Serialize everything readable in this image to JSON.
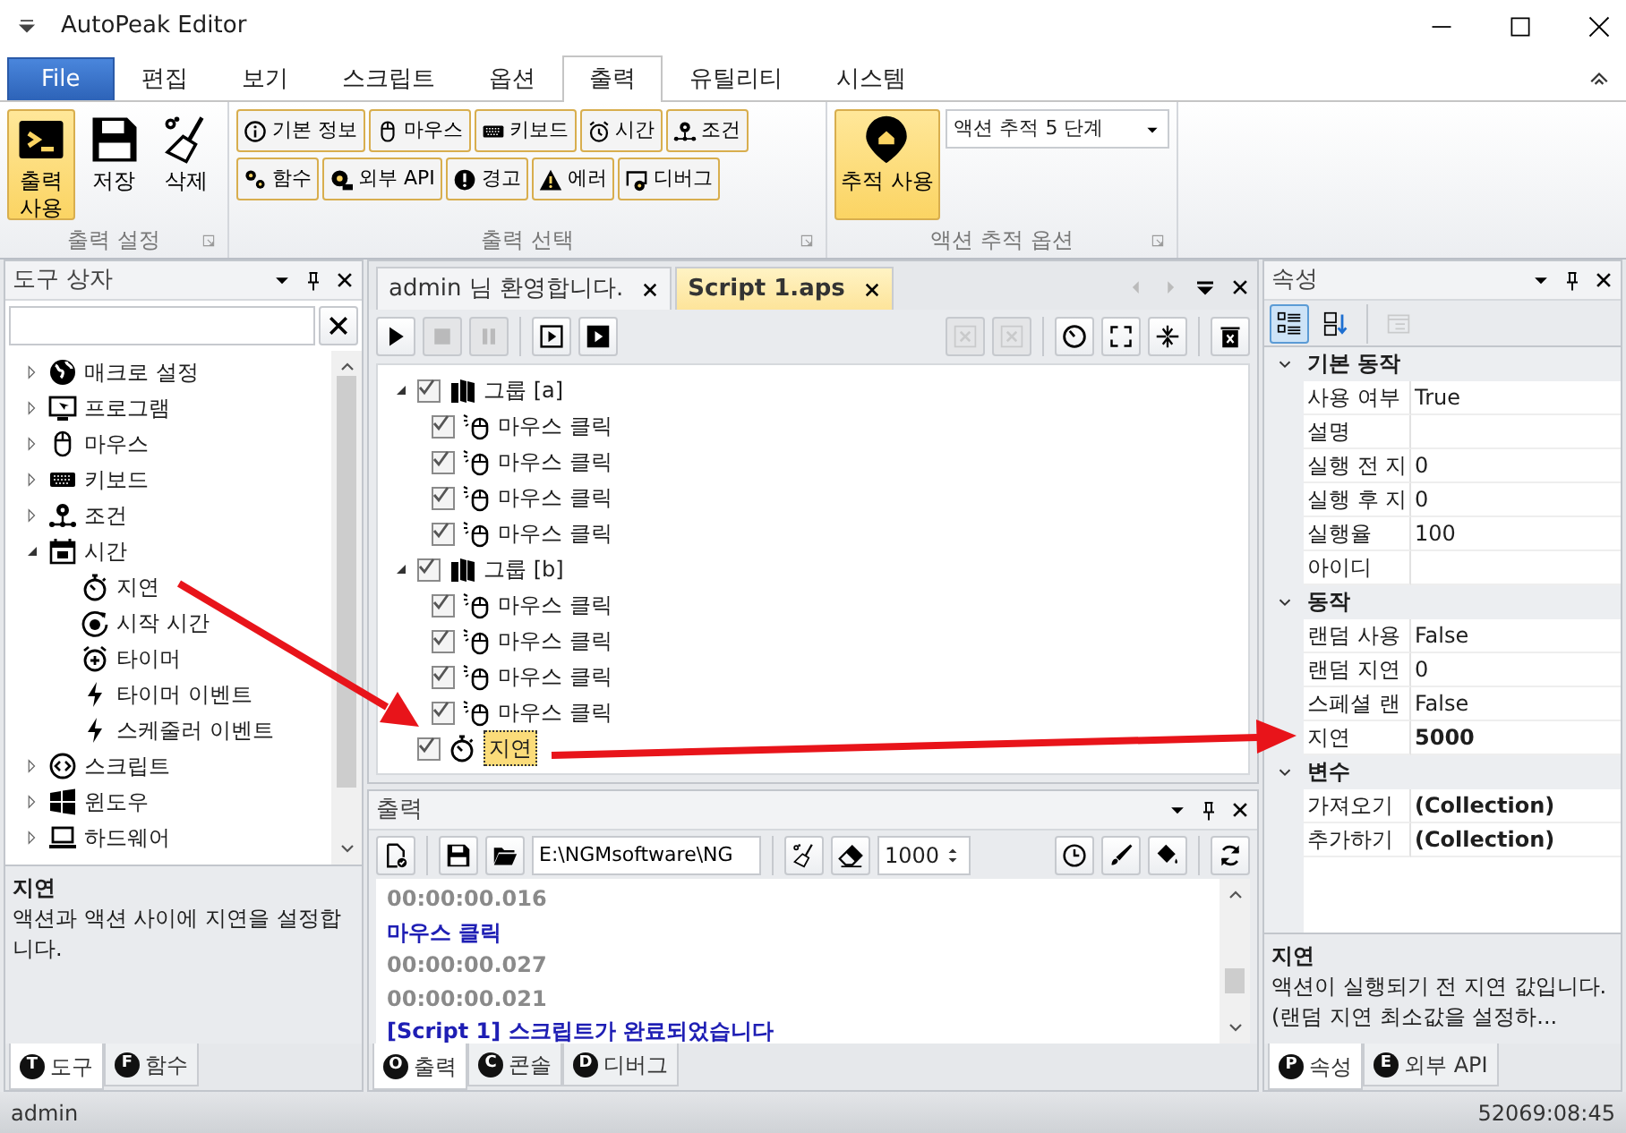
{
  "window": {
    "title": "AutoPeak Editor"
  },
  "ribbon_tabs": [
    {
      "label": "File",
      "kind": "file",
      "selected": false
    },
    {
      "label": "편집",
      "kind": "tab",
      "selected": false
    },
    {
      "label": "보기",
      "kind": "tab",
      "selected": false
    },
    {
      "label": "스크립트",
      "kind": "tab",
      "selected": false
    },
    {
      "label": "옵션",
      "kind": "tab",
      "selected": false
    },
    {
      "label": "출력",
      "kind": "tab",
      "selected": true
    },
    {
      "label": "유틸리티",
      "kind": "tab",
      "selected": false
    },
    {
      "label": "시스템",
      "kind": "tab",
      "selected": false
    }
  ],
  "output_settings": {
    "title": "출력 설정",
    "buttons": [
      {
        "label": "출력 사용",
        "on": true
      },
      {
        "label": "저장",
        "on": false
      },
      {
        "label": "삭제",
        "on": false
      }
    ]
  },
  "output_select": {
    "title": "출력 선택",
    "rows": [
      [
        {
          "label": "기본 정보",
          "on": true
        },
        {
          "label": "마우스",
          "on": true
        },
        {
          "label": "키보드",
          "on": true
        },
        {
          "label": "시간",
          "on": true
        },
        {
          "label": "조건",
          "on": true
        }
      ],
      [
        {
          "label": "함수",
          "on": true
        },
        {
          "label": "외부 API",
          "on": true
        },
        {
          "label": "경고",
          "on": true
        },
        {
          "label": "에러",
          "on": true
        },
        {
          "label": "디버그",
          "on": true
        }
      ]
    ]
  },
  "trace_options": {
    "title": "액션 추적 옵션",
    "button": {
      "label": "추적 사용",
      "on": true
    },
    "dropdown": {
      "value": "액션 추적 5 단계"
    }
  },
  "toolbox": {
    "title": "도구 상자",
    "items": [
      {
        "label": "매크로 설정",
        "expanded": false
      },
      {
        "label": "프로그램",
        "expanded": false
      },
      {
        "label": "마우스",
        "expanded": false
      },
      {
        "label": "키보드",
        "expanded": false
      },
      {
        "label": "조건",
        "expanded": false
      },
      {
        "label": "시간",
        "expanded": true,
        "children": [
          {
            "label": "지연"
          },
          {
            "label": "시작 시간"
          },
          {
            "label": "타이머"
          },
          {
            "label": "타이머 이벤트"
          },
          {
            "label": "스케줄러 이벤트"
          }
        ]
      },
      {
        "label": "스크립트",
        "expanded": false
      },
      {
        "label": "윈도우",
        "expanded": false
      },
      {
        "label": "하드웨어",
        "expanded": false
      }
    ],
    "description": {
      "title": "지연",
      "text": "액션과 액션 사이에 지연을 설정합니다."
    },
    "tabs": [
      {
        "badge": "T",
        "label": "도구",
        "selected": true
      },
      {
        "badge": "F",
        "label": "함수",
        "selected": false
      }
    ]
  },
  "document_tabs": [
    {
      "label": "admin 님 환영합니다.",
      "selected": false
    },
    {
      "label": "Script 1.aps",
      "selected": true
    }
  ],
  "script_toolbar": [
    {
      "disabled": false
    },
    {
      "disabled": true
    },
    {
      "disabled": true
    },
    {
      "disabled": false
    },
    {
      "disabled": false
    },
    {
      "disabled": true
    },
    {
      "disabled": true
    },
    {
      "disabled": false
    },
    {
      "disabled": false
    },
    {
      "disabled": false
    },
    {
      "disabled": false
    }
  ],
  "script": [
    {
      "kind": "group",
      "label": "그룹 [a]",
      "checked": true,
      "expanded": true,
      "selected": false,
      "children": [
        {
          "kind": "mouse",
          "label": "마우스 클릭",
          "checked": true,
          "selected": false
        },
        {
          "kind": "mouse",
          "label": "마우스 클릭",
          "checked": true,
          "selected": false
        },
        {
          "kind": "mouse",
          "label": "마우스 클릭",
          "checked": true,
          "selected": false
        },
        {
          "kind": "mouse",
          "label": "마우스 클릭",
          "checked": true,
          "selected": false
        }
      ]
    },
    {
      "kind": "group",
      "label": "그룹 [b]",
      "checked": true,
      "expanded": true,
      "selected": false,
      "children": [
        {
          "kind": "mouse",
          "label": "마우스 클릭",
          "checked": true,
          "selected": false
        },
        {
          "kind": "mouse",
          "label": "마우스 클릭",
          "checked": true,
          "selected": false
        },
        {
          "kind": "mouse",
          "label": "마우스 클릭",
          "checked": true,
          "selected": false
        },
        {
          "kind": "mouse",
          "label": "마우스 클릭",
          "checked": true,
          "selected": false
        }
      ]
    },
    {
      "kind": "delay",
      "label": "지연",
      "checked": true,
      "selected": true
    }
  ],
  "output": {
    "title": "출력",
    "path": "E:\\NGMsoftware\\NG",
    "count": "1000",
    "log": [
      {
        "kind": "time",
        "text": "00:00:00.016"
      },
      {
        "kind": "message",
        "text": "마우스 클릭"
      },
      {
        "kind": "time",
        "text": "00:00:00.027"
      },
      {
        "kind": "time",
        "text": "00:00:00.021"
      },
      {
        "kind": "message",
        "text": "[Script 1] 스크립트가 완료되었습니다"
      }
    ],
    "tabs": [
      {
        "badge": "O",
        "label": "출력",
        "selected": true
      },
      {
        "badge": "C",
        "label": "콘솔",
        "selected": false
      },
      {
        "badge": "D",
        "label": "디버그",
        "selected": false
      }
    ]
  },
  "properties": {
    "title": "속성",
    "toolbar": [
      {
        "selected": true,
        "disabled": false
      },
      {
        "selected": false,
        "disabled": false
      },
      {
        "selected": false,
        "disabled": true
      }
    ],
    "categories": [
      {
        "name": "기본 동작",
        "expanded": true,
        "rows": [
          {
            "name": "사용 여부",
            "value": "True",
            "modified": false
          },
          {
            "name": "설명",
            "modified": false
          },
          {
            "name": "실행 전 지",
            "value": "0",
            "modified": false
          },
          {
            "name": "실행 후 지",
            "value": "0",
            "modified": false
          },
          {
            "name": "실행율",
            "value": "100",
            "modified": false
          },
          {
            "name": "아이디",
            "modified": false
          }
        ]
      },
      {
        "name": "동작",
        "expanded": true,
        "rows": [
          {
            "name": "랜덤 사용",
            "value": "False",
            "modified": false
          },
          {
            "name": "랜덤 지연",
            "value": "0",
            "modified": false
          },
          {
            "name": "스페셜 랜",
            "value": "False",
            "modified": false
          },
          {
            "name": "지연",
            "value": "5000",
            "modified": true
          }
        ]
      },
      {
        "name": "변수",
        "expanded": true,
        "rows": [
          {
            "name": "가져오기",
            "value": "(Collection)",
            "modified": true
          },
          {
            "name": "추가하기",
            "value": "(Collection)",
            "modified": true
          }
        ]
      }
    ],
    "description": {
      "title": "지연",
      "text": "액션이 실행되기 전 지연 값입니다. (랜덤 지연 최소값을 설정하..."
    },
    "tabs": [
      {
        "badge": "P",
        "label": "속성",
        "selected": true
      },
      {
        "badge": "E",
        "label": "외부 API",
        "selected": false
      }
    ]
  },
  "status_bar": {
    "user": "admin",
    "time": "52069:08:45"
  }
}
